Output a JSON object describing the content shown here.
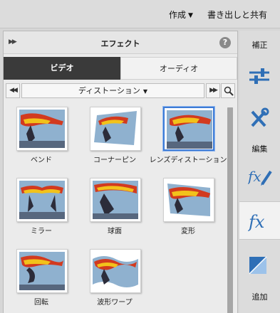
{
  "topbar": {
    "create_label": "作成",
    "export_label": "書き出しと共有"
  },
  "panel": {
    "title": "エフェクト",
    "tabs": [
      {
        "label": "ビデオ",
        "active": true
      },
      {
        "label": "オーディオ",
        "active": false
      }
    ],
    "category": "ディストーション",
    "items": [
      {
        "label": "ベンド",
        "selected": false
      },
      {
        "label": "コーナーピン",
        "selected": false
      },
      {
        "label": "レンズディストーション",
        "selected": true
      },
      {
        "label": "ミラー",
        "selected": false
      },
      {
        "label": "球面",
        "selected": false
      },
      {
        "label": "変形",
        "selected": false
      },
      {
        "label": "回転",
        "selected": false
      },
      {
        "label": "波形ワープ",
        "selected": false
      }
    ]
  },
  "sidebar": {
    "adjust_label": "補正",
    "edit_label": "編集",
    "add_label": "追加",
    "icons": [
      "adjust-sliders-icon",
      "tools-icon",
      "applied-fx-icon",
      "fx-icon",
      "transition-icon"
    ]
  },
  "colors": {
    "accent": "#3d7bd6",
    "tab_active": "#3a3a3a",
    "fx_blue": "#2f6fb6"
  }
}
